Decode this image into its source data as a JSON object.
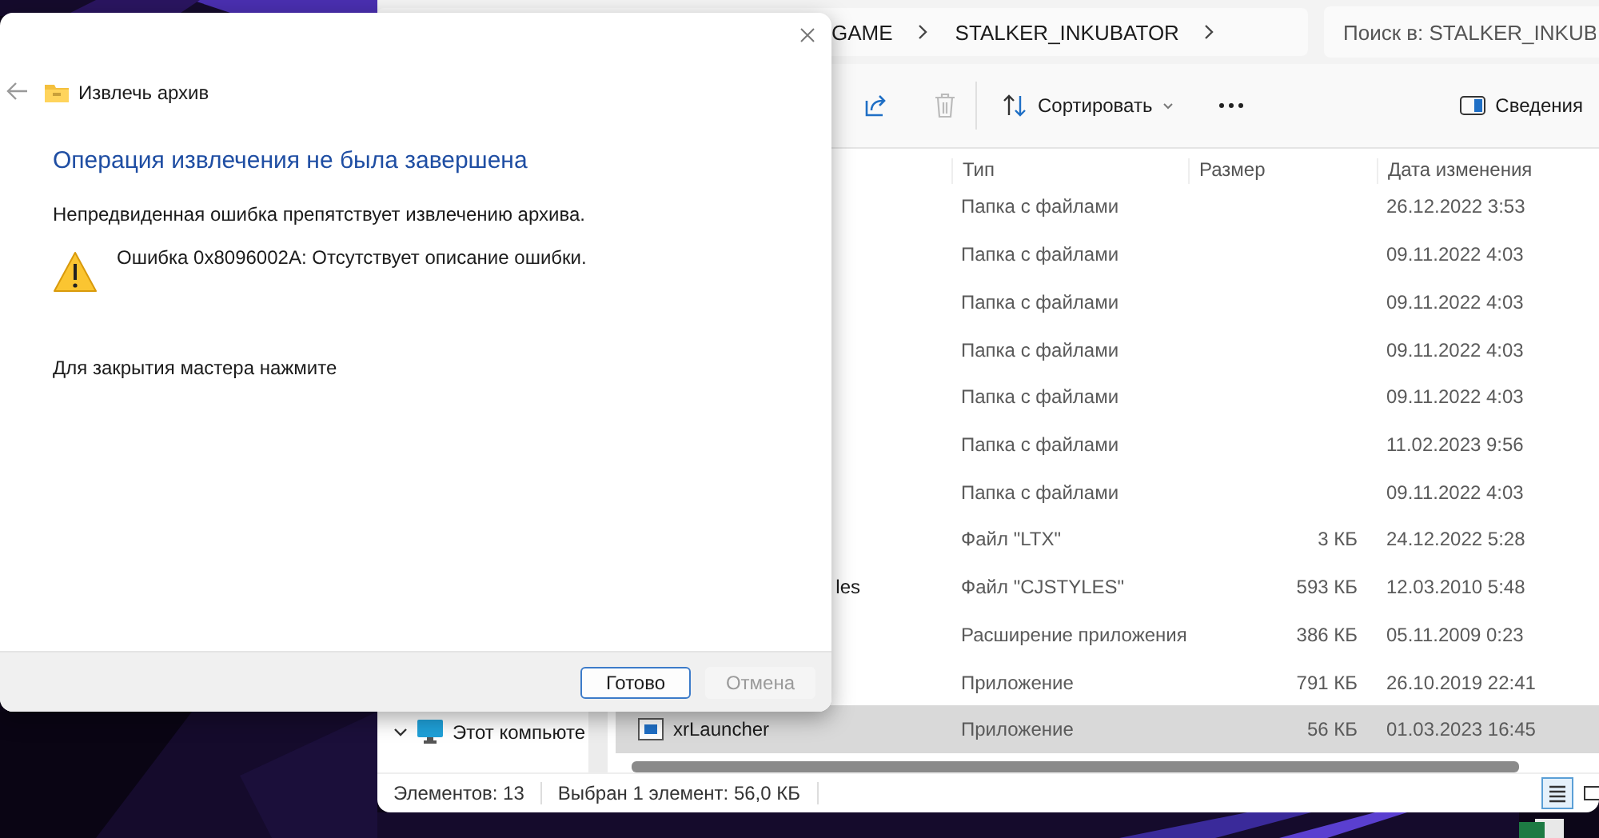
{
  "explorer": {
    "breadcrumb": [
      {
        "label": "GAME"
      },
      {
        "label": "STALKER_INKUBATOR"
      }
    ],
    "search": {
      "placeholder": "Поиск в: STALKER_INKUB"
    },
    "toolbar": {
      "sort_label": "Сортировать",
      "details_label": "Сведения"
    },
    "columns": [
      "Тип",
      "Размер",
      "Дата изменения"
    ],
    "rows": [
      {
        "type": "Папка с файлами",
        "date": "26.12.2022 3:53",
        "selected": false
      },
      {
        "type": "Папка с файлами",
        "date": "09.11.2022 4:03",
        "selected": false
      },
      {
        "type": "Папка с файлами",
        "date": "09.11.2022 4:03",
        "selected": false
      },
      {
        "type": "Папка с файлами",
        "date": "09.11.2022 4:03",
        "selected": false
      },
      {
        "type": "Папка с файлами",
        "date": "09.11.2022 4:03",
        "selected": false
      },
      {
        "type": "Папка с файлами",
        "date": "11.02.2023 9:56",
        "selected": false
      },
      {
        "type": "Папка с файлами",
        "date": "09.11.2022 4:03",
        "selected": false
      },
      {
        "type": "Файл \"LTX\"",
        "size": "3 КБ",
        "date": "24.12.2022 5:28",
        "selected": false
      },
      {
        "name_tail": "les",
        "type": "Файл \"CJSTYLES\"",
        "size": "593 КБ",
        "date": "12.03.2010 5:48",
        "selected": false
      },
      {
        "type": "Расширение приложения",
        "size": "386 КБ",
        "date": "05.11.2009 0:23",
        "selected": false
      },
      {
        "type": "Приложение",
        "size": "791 КБ",
        "date": "26.10.2019 22:41",
        "selected": false
      },
      {
        "name": "xrLauncher",
        "type": "Приложение",
        "size": "56 КБ",
        "date": "01.03.2023 16:45",
        "selected": true
      }
    ],
    "nav": [
      {
        "label": "Этот компьюте",
        "expanded": true
      }
    ],
    "status": {
      "count": "Элементов: 13",
      "selection": "Выбран 1 элемент: 56,0 КБ"
    },
    "views": [
      {
        "kind": "details",
        "selected": true
      },
      {
        "kind": "tiles",
        "selected": false
      }
    ]
  },
  "dialog": {
    "title": "Извлечь архив",
    "heading": "Операция извлечения не была завершена",
    "message": "Непредвиденная ошибка препятствует извлечению архива.",
    "error": "Ошибка 0x8096002A: Отсутствует описание ошибки.",
    "hint": "Для закрытия мастера нажмите",
    "buttons": [
      {
        "label": "Готово",
        "disabled": false
      },
      {
        "label": "Отмена",
        "disabled": true
      }
    ]
  }
}
